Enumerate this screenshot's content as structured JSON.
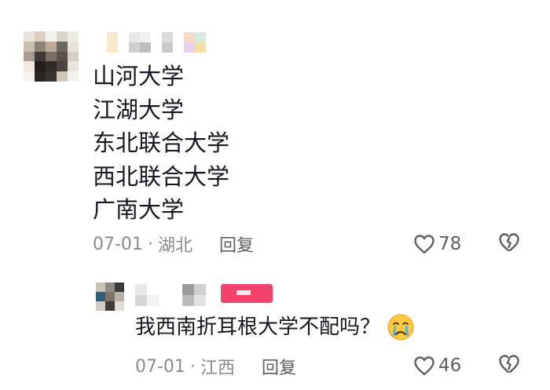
{
  "comment": {
    "lines": [
      "山河大学",
      "江湖大学",
      "东北联合大学",
      "西北联合大学",
      "广南大学"
    ],
    "date": "07-01",
    "separator": "·",
    "location": "湖北",
    "reply_label": "回复",
    "likes": "78"
  },
  "reply": {
    "text": "我西南折耳根大学不配吗？",
    "emoji": "crying-face-emoji",
    "date": "07-01",
    "separator": "·",
    "location": "江西",
    "reply_label": "回复",
    "likes": "46"
  },
  "icons": {
    "like": "heart-outline-icon",
    "dislike": "broken-heart-icon"
  },
  "colors": {
    "text": "#161823",
    "meta": "#8a8b91",
    "icon": "#5f6067",
    "badge": "#f2426b"
  }
}
